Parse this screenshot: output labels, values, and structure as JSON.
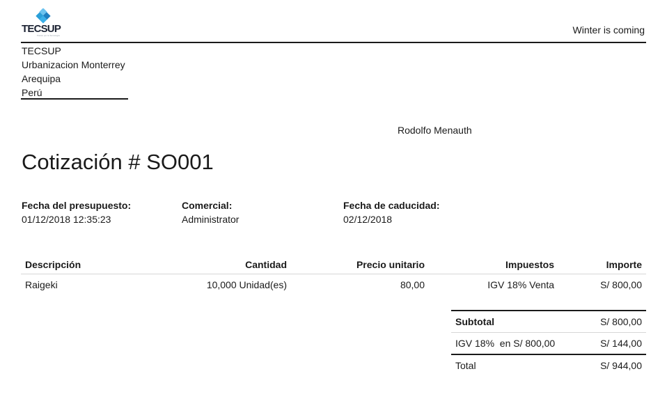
{
  "header": {
    "logo_text": "TECSUP",
    "logo_subtext": "Pasión por la Tecnología",
    "tagline": "Winter is coming"
  },
  "company": {
    "name": "TECSUP",
    "street": "Urbanizacion Monterrey",
    "city": "Arequipa",
    "country": "Perú"
  },
  "customer": {
    "name": "Rodolfo Menauth"
  },
  "document": {
    "title": "Cotización # SO001"
  },
  "info": {
    "date_label": "Fecha del presupuesto:",
    "date_value": "01/12/2018 12:35:23",
    "salesperson_label": "Comercial:",
    "salesperson_value": "Administrator",
    "expiry_label": "Fecha de caducidad:",
    "expiry_value": "02/12/2018"
  },
  "lines": {
    "headers": {
      "description": "Descripción",
      "quantity": "Cantidad",
      "unit_price": "Precio unitario",
      "taxes": "Impuestos",
      "amount": "Importe"
    },
    "rows": [
      {
        "description": "Raigeki",
        "quantity": "10,000 Unidad(es)",
        "unit_price": "80,00",
        "taxes": "IGV 18% Venta",
        "amount": "S/ 800,00"
      }
    ]
  },
  "totals": {
    "subtotal_label": "Subtotal",
    "subtotal_value": "S/ 800,00",
    "tax_label": "IGV 18%  en S/ 800,00",
    "tax_value": "S/ 144,00",
    "total_label": "Total",
    "total_value": "S/ 944,00"
  },
  "colors": {
    "text": "#1a1a1a",
    "logo_blue": "#2a9fd8",
    "rule_light": "#d6d6d6"
  }
}
